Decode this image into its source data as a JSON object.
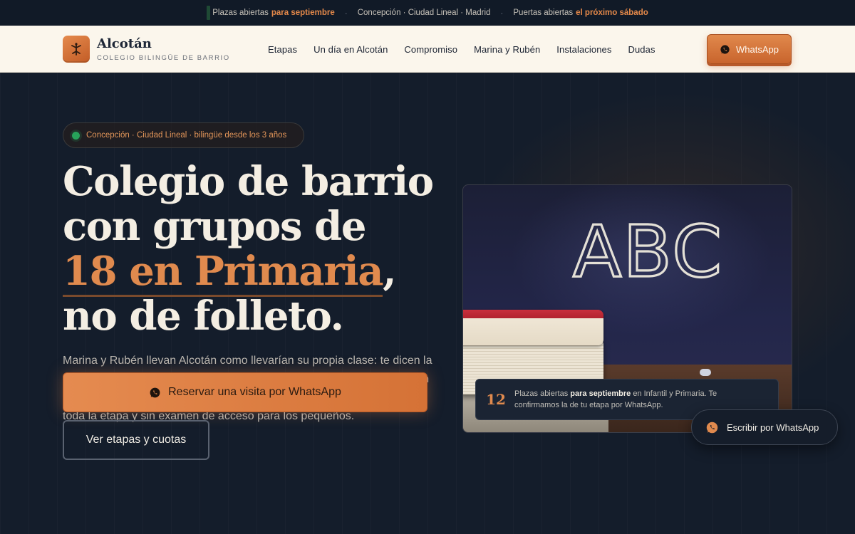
{
  "topbar": {
    "item1_text": "Plazas abiertas",
    "item1_accent": "para septiembre",
    "item2_text": "Concepción · Ciudad Lineal · Madrid",
    "item3_text": "Puertas abiertas",
    "item3_accent": "el próximo sábado"
  },
  "brand": {
    "name": "Alcotán",
    "tagline": "COLEGIO BILINGÜE DE BARRIO",
    "logo_icon": "kite-bird-icon"
  },
  "nav": {
    "items": [
      "Etapas",
      "Un día en Alcotán",
      "Compromiso",
      "Marina y Rubén",
      "Instalaciones",
      "Dudas"
    ]
  },
  "header_cta": {
    "label": "WhatsApp",
    "icon": "whatsapp-icon"
  },
  "hero": {
    "pill": "Concepción · Ciudad Lineal · bilingüe desde los 3 años",
    "title_line1": "Colegio de barrio",
    "title_line2": "con grupos de",
    "title_highlight": "18 en Primaria",
    "title_comma": ",",
    "title_line4": "no de folleto.",
    "lead": "Marina y Rubén llevan Alcotán como llevarían su propia clase: te dicen la ratio real, te enseñan un aula el día que quieras entrar y no prometen un colegio distinto al que existe. Bilingüe desde Infantil, tutor de referencia toda la etapa y sin examen de acceso para los pequeños.",
    "cta_primary": "Reservar una visita por WhatsApp",
    "cta_secondary": "Ver etapas y cuotas"
  },
  "photo": {
    "chalk_text": "ABC",
    "caption_number": "12",
    "caption_pre": "Plazas abiertas",
    "caption_bold": "para septiembre",
    "caption_post": "en Infantil y Primaria. Te confirmamos la de tu etapa por WhatsApp."
  },
  "floating_cta": {
    "label": "Escribir por WhatsApp",
    "icon": "whatsapp-icon"
  },
  "colors": {
    "accent": "#e08a4e",
    "dark_bg": "#141d2b",
    "header_bg": "#fbf6ec",
    "status_green": "#27a35a"
  }
}
